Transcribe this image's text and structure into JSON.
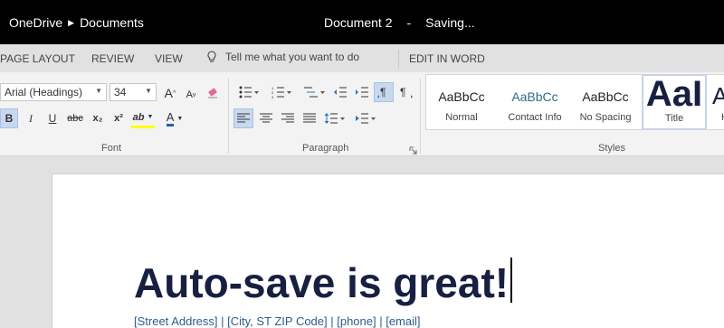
{
  "titlebar": {
    "breadcrumb_root": "OneDrive",
    "breadcrumb_folder": "Documents",
    "doc_name": "Document 2",
    "separator": "-",
    "status": "Saving..."
  },
  "menu": {
    "page_layout": "PAGE LAYOUT",
    "review": "REVIEW",
    "view": "VIEW",
    "tell_me": "Tell me what you want to do",
    "edit_in_word": "EDIT IN WORD"
  },
  "font_group": {
    "font_name": "Arial (Headings)",
    "font_size": "34",
    "label": "Font",
    "grow": "A",
    "shrink": "A",
    "bold": "B",
    "italic": "I",
    "underline": "U",
    "strike": "abc",
    "subscript": "x₂",
    "superscript": "x²",
    "highlight": "ab",
    "font_color": "A"
  },
  "paragraph_group": {
    "label": "Paragraph"
  },
  "styles_group": {
    "label": "Styles",
    "items": [
      {
        "sample": "AaBbCc",
        "name": "Normal"
      },
      {
        "sample": "AaBbCc",
        "name": "Contact Info"
      },
      {
        "sample": "AaBbCc",
        "name": "No Spacing"
      },
      {
        "sample": "AaI",
        "name": "Title"
      },
      {
        "sample": "A",
        "name": "H"
      }
    ]
  },
  "document": {
    "heading": "Auto-save is great!",
    "address_line": "[Street Address] | [City, ST ZIP Code] | [phone] | [email]"
  },
  "colors": {
    "titlebar_bg": "#000000",
    "heading": "#172041",
    "accent_blue": "#2e75b6",
    "highlight_yellow": "#ffff00",
    "font_color_red": "#1f5ebd",
    "active_button": "#c8d8ef"
  }
}
